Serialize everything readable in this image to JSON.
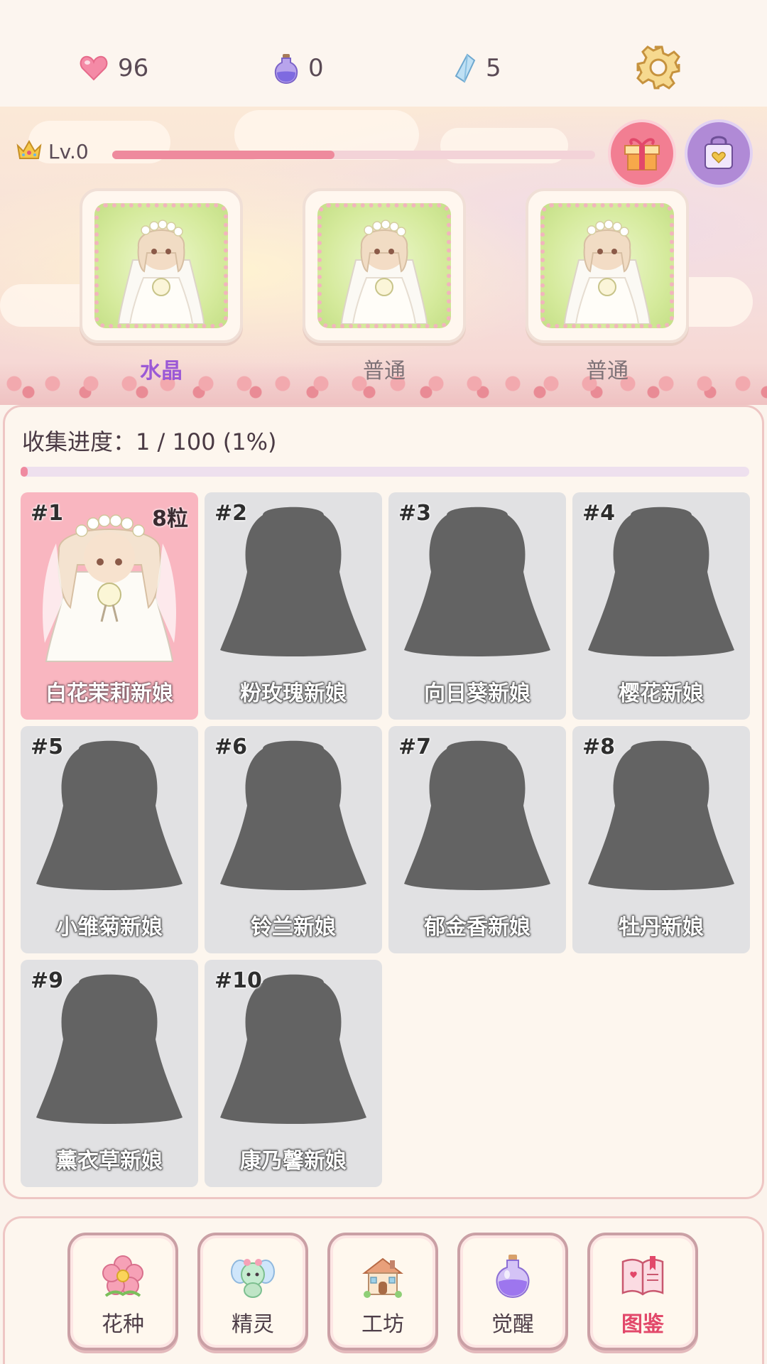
{
  "resources": {
    "hearts": "96",
    "potions": "0",
    "crystals": "5"
  },
  "level": {
    "label": "Lv.0",
    "progress": 0.46
  },
  "slots": [
    {
      "rarity": "水晶"
    },
    {
      "rarity": "普通"
    },
    {
      "rarity": "普通"
    }
  ],
  "collection": {
    "progress_text": "收集进度：1 / 100 (1%)",
    "progress": 0.01,
    "items": [
      {
        "num": "#1",
        "name": "白花茉莉新娘",
        "qty": "8粒",
        "owned": true
      },
      {
        "num": "#2",
        "name": "粉玫瑰新娘",
        "owned": false
      },
      {
        "num": "#3",
        "name": "向日葵新娘",
        "owned": false
      },
      {
        "num": "#4",
        "name": "樱花新娘",
        "owned": false
      },
      {
        "num": "#5",
        "name": "小雏菊新娘",
        "owned": false
      },
      {
        "num": "#6",
        "name": "铃兰新娘",
        "owned": false
      },
      {
        "num": "#7",
        "name": "郁金香新娘",
        "owned": false
      },
      {
        "num": "#8",
        "name": "牡丹新娘",
        "owned": false
      },
      {
        "num": "#9",
        "name": "薰衣草新娘",
        "owned": false
      },
      {
        "num": "#10",
        "name": "康乃馨新娘",
        "owned": false
      }
    ]
  },
  "nav": {
    "tabs": [
      {
        "label": "花种",
        "icon": "flower-icon"
      },
      {
        "label": "精灵",
        "icon": "fairy-icon"
      },
      {
        "label": "工坊",
        "icon": "workshop-icon"
      },
      {
        "label": "觉醒",
        "icon": "potion-icon"
      },
      {
        "label": "图鉴",
        "icon": "book-icon",
        "active": true
      }
    ]
  },
  "colors": {
    "accent_pink": "#ef8aa0",
    "crystal_purple": "#9b59d6",
    "owned_card": "#f9b6c0",
    "locked_card": "#e1e1e3",
    "active_tab": "#e2486a"
  }
}
